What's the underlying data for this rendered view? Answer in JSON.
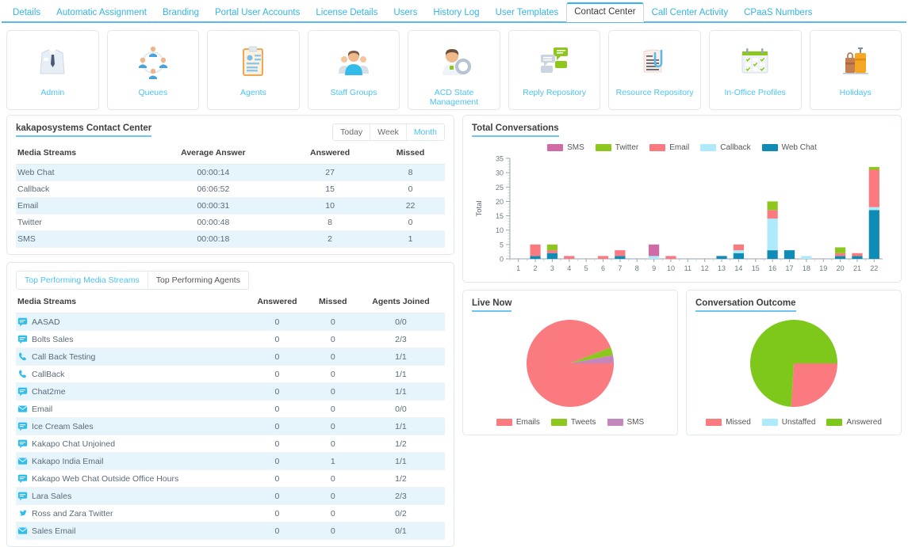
{
  "nav": {
    "tabs": [
      {
        "label": "Details",
        "active": false
      },
      {
        "label": "Automatic Assignment",
        "active": false
      },
      {
        "label": "Branding",
        "active": false
      },
      {
        "label": "Portal User Accounts",
        "active": false
      },
      {
        "label": "License Details",
        "active": false
      },
      {
        "label": "Users",
        "active": false
      },
      {
        "label": "History Log",
        "active": false
      },
      {
        "label": "User Templates",
        "active": false
      },
      {
        "label": "Contact Center",
        "active": true
      },
      {
        "label": "Call Center Activity",
        "active": false
      },
      {
        "label": "CPaaS Numbers",
        "active": false
      }
    ]
  },
  "cards": [
    {
      "label": "Admin",
      "icon": "shirt-tie-icon"
    },
    {
      "label": "Queues",
      "icon": "queue-users-icon"
    },
    {
      "label": "Agents",
      "icon": "clipboard-profile-icon"
    },
    {
      "label": "Staff Groups",
      "icon": "people-group-icon"
    },
    {
      "label": "ACD State Management",
      "icon": "agent-gear-icon"
    },
    {
      "label": "Reply Repository",
      "icon": "chat-bubbles-icon"
    },
    {
      "label": "Resource Repository",
      "icon": "document-paperclip-icon"
    },
    {
      "label": "In-Office Profiles",
      "icon": "calendar-check-icon"
    },
    {
      "label": "Holidays",
      "icon": "luggage-icon"
    }
  ],
  "summary": {
    "title": "kakaposystems Contact Center",
    "ranges": [
      {
        "label": "Today",
        "active": false
      },
      {
        "label": "Week",
        "active": false
      },
      {
        "label": "Month",
        "active": true
      }
    ],
    "columns": [
      "Media Streams",
      "Average Answer",
      "Answered",
      "Missed"
    ],
    "rows": [
      {
        "stream": "Web Chat",
        "average": "00:00:14",
        "answered": "27",
        "missed": "8"
      },
      {
        "stream": "Callback",
        "average": "06:06:52",
        "answered": "15",
        "missed": "0"
      },
      {
        "stream": "Email",
        "average": "00:00:31",
        "answered": "10",
        "missed": "22"
      },
      {
        "stream": "Twitter",
        "average": "00:00:48",
        "answered": "8",
        "missed": "0"
      },
      {
        "stream": "SMS",
        "average": "00:00:18",
        "answered": "2",
        "missed": "1"
      }
    ]
  },
  "topPerforming": {
    "tabs": [
      {
        "label": "Top Performing Media Streams",
        "active": true
      },
      {
        "label": "Top Performing Agents",
        "active": false
      }
    ],
    "columns": [
      "Media Streams",
      "Answered",
      "Missed",
      "Agents Joined"
    ],
    "rows": [
      {
        "icon": "chat-icon",
        "stream": "AASAD",
        "answered": "0",
        "missed": "0",
        "joined": "0/0"
      },
      {
        "icon": "chat-icon",
        "stream": "Bolts Sales",
        "answered": "0",
        "missed": "0",
        "joined": "2/3"
      },
      {
        "icon": "phone-icon",
        "stream": "Call Back Testing",
        "answered": "0",
        "missed": "0",
        "joined": "1/1"
      },
      {
        "icon": "phone-icon",
        "stream": "CallBack",
        "answered": "0",
        "missed": "0",
        "joined": "1/1"
      },
      {
        "icon": "chat-icon",
        "stream": "Chat2me",
        "answered": "0",
        "missed": "0",
        "joined": "1/1"
      },
      {
        "icon": "email-icon",
        "stream": "Email",
        "answered": "0",
        "missed": "0",
        "joined": "0/0"
      },
      {
        "icon": "chat-icon",
        "stream": "Ice Cream Sales",
        "answered": "0",
        "missed": "0",
        "joined": "1/1"
      },
      {
        "icon": "chat-icon",
        "stream": "Kakapo Chat Unjoined",
        "answered": "0",
        "missed": "0",
        "joined": "1/2"
      },
      {
        "icon": "email-icon",
        "stream": "Kakapo India Email",
        "answered": "0",
        "missed": "1",
        "joined": "1/1"
      },
      {
        "icon": "chat-icon",
        "stream": "Kakapo Web Chat Outside Office Hours",
        "answered": "0",
        "missed": "0",
        "joined": "1/2"
      },
      {
        "icon": "chat-icon",
        "stream": "Lara Sales",
        "answered": "0",
        "missed": "0",
        "joined": "2/3"
      },
      {
        "icon": "twitter-icon",
        "stream": "Ross and Zara Twitter",
        "answered": "0",
        "missed": "0",
        "joined": "0/2"
      },
      {
        "icon": "email-icon",
        "stream": "Sales Email",
        "answered": "0",
        "missed": "0",
        "joined": "0/1"
      }
    ]
  },
  "colors": {
    "sms": "#d островcc",
    "smsHex": "#d munic",
    "SMS": "#d16ba5",
    "Twitter": "#8dc71e",
    "Email": "#fa7a80",
    "Callback": "#aeeafb",
    "WebChat": "#0e8cb5",
    "Missed": "#fa7a80",
    "Unstaffed": "#aeeafb",
    "Answered": "#7dc81b",
    "Emails": "#fa7a80",
    "Tweets": "#8dc71e"
  },
  "chart_data": [
    {
      "type": "bar",
      "stacked": true,
      "title": "Total Conversations",
      "xlabel": "",
      "ylabel": "Total",
      "ylim": [
        0,
        35
      ],
      "yticks": [
        0,
        5,
        10,
        15,
        20,
        25,
        30,
        35
      ],
      "grid": false,
      "legend_position": "top-right",
      "categories": [
        "1",
        "2",
        "3",
        "4",
        "5",
        "6",
        "7",
        "8",
        "9",
        "10",
        "11",
        "12",
        "13",
        "14",
        "15",
        "16",
        "17",
        "18",
        "19",
        "20",
        "21",
        "22"
      ],
      "series": [
        {
          "name": "Web Chat",
          "color": "#0e8cb5",
          "values": [
            0,
            1,
            2,
            0,
            0,
            0,
            1,
            0,
            0,
            0,
            0,
            0,
            1,
            2,
            0,
            3,
            3,
            0,
            0,
            1,
            1,
            17
          ]
        },
        {
          "name": "Callback",
          "color": "#aeeafb",
          "values": [
            0,
            0,
            0,
            0,
            0,
            0,
            0,
            0,
            1,
            0,
            0,
            0,
            0,
            1,
            0,
            11,
            0,
            1,
            0,
            0,
            0,
            1
          ]
        },
        {
          "name": "Email",
          "color": "#fa7a80",
          "values": [
            0,
            4,
            1,
            1,
            0,
            1,
            2,
            0,
            0,
            1,
            0,
            0,
            0,
            2,
            0,
            3,
            0,
            0,
            0,
            1,
            1,
            13
          ]
        },
        {
          "name": "Twitter",
          "color": "#8dc71e",
          "values": [
            0,
            0,
            2,
            0,
            0,
            0,
            0,
            0,
            0,
            0,
            0,
            0,
            0,
            0,
            0,
            3,
            0,
            0,
            0,
            2,
            0,
            1
          ]
        },
        {
          "name": "SMS",
          "color": "#d16ba5",
          "values": [
            0,
            0,
            0,
            0,
            0,
            0,
            0,
            0,
            4,
            0,
            0,
            0,
            0,
            0,
            0,
            0,
            0,
            0,
            0,
            0,
            0,
            0
          ]
        }
      ],
      "legend": [
        "SMS",
        "Twitter",
        "Email",
        "Callback",
        "Web Chat"
      ]
    },
    {
      "type": "pie",
      "title": "Live Now",
      "legend_position": "bottom",
      "labels": [
        "Emails",
        "Tweets",
        "SMS"
      ],
      "values": [
        94,
        3,
        3
      ],
      "colors": [
        "#fa7a80",
        "#8dc71e",
        "#c487bd"
      ]
    },
    {
      "type": "pie",
      "title": "Conversation Outcome",
      "legend_position": "bottom",
      "labels": [
        "Missed",
        "Unstaffed",
        "Answered"
      ],
      "values": [
        26,
        0,
        74
      ],
      "colors": [
        "#fa7a80",
        "#aeeafb",
        "#7dc81b"
      ]
    }
  ]
}
